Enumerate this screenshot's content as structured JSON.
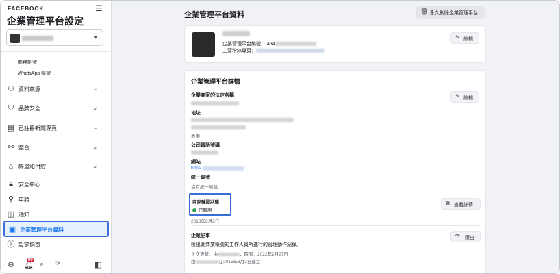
{
  "sidebar": {
    "brand": "FACEBOOK",
    "title": "企業管理平台設定",
    "subitems": [
      "商務帳號",
      "WhatsApp 帳號"
    ],
    "nav": [
      {
        "label": "資料來源",
        "icon": "people-icon"
      },
      {
        "label": "品牌安全",
        "icon": "shield-icon"
      },
      {
        "label": "已註冊新聞專頁",
        "icon": "newspaper-icon"
      },
      {
        "label": "整合",
        "icon": "integrations-icon"
      },
      {
        "label": "帳單和付款",
        "icon": "bank-icon"
      },
      {
        "label": "安全中心",
        "icon": "lock-icon"
      },
      {
        "label": "申請",
        "icon": "person-add-icon"
      },
      {
        "label": "通知",
        "icon": "notification-icon"
      },
      {
        "label": "企業管理平台資料",
        "icon": "briefcase-icon"
      },
      {
        "label": "設定指南",
        "icon": "help-icon"
      }
    ],
    "bottom_badge": "99"
  },
  "main": {
    "title": "企業管理平台資料",
    "delete_button": "永久刪除企業管理平台",
    "card1": {
      "id_label": "企業管理平台編號： 434",
      "page_label": "主要粉絲專頁：",
      "edit": "編輯"
    },
    "card2": {
      "title": "企業管理平台詳情",
      "legal_name_label": "企業商家的法定名稱",
      "edit": "編輯",
      "address_label": "地址",
      "address_region": "香港",
      "phone_label": "公司電話號碼",
      "website_label": "網站",
      "website_value": "https",
      "unified_id_label": "統一編號",
      "unified_id_value": "沒有統一編號",
      "verify_label": "商家驗證狀態",
      "verify_status": "已驗證",
      "verify_date": "2018年8月3日",
      "view_details": "查看詳情",
      "record_label": "企業記事",
      "record_desc": "匯出此商業帳號的工作人員所進行的管理動作紀錄。",
      "last_update_prefix": "上次更新：由",
      "last_update_suffix": "，時間：2022年1月27日",
      "created_prefix": "由",
      "created_suffix": "在2015年3月2日建立",
      "export": "匯出"
    }
  },
  "colors": {
    "accent": "#1877f2",
    "highlight_border": "#3a6fd8",
    "verified": "#31a24c"
  }
}
